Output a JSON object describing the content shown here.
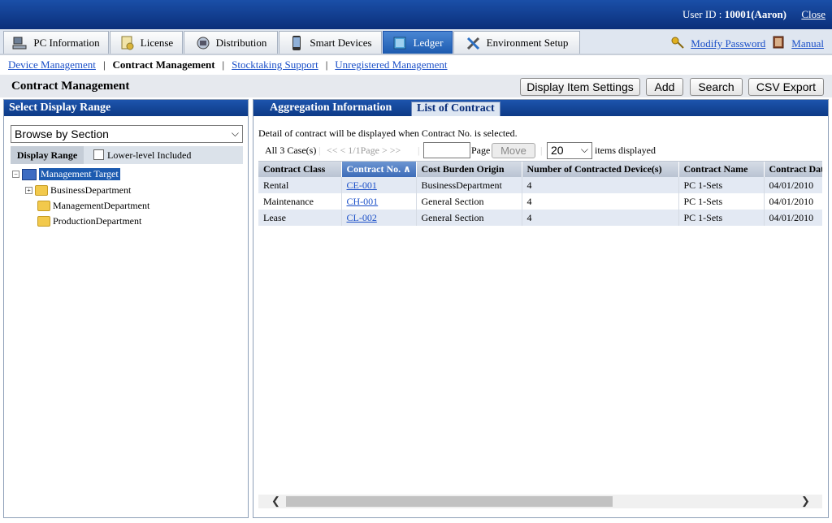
{
  "header": {
    "user_label": "User ID : ",
    "user_value": "10001(Aaron)",
    "close": "Close"
  },
  "tabs": [
    {
      "label": "PC Information",
      "icon": "pc-icon"
    },
    {
      "label": "License",
      "icon": "license-icon"
    },
    {
      "label": "Distribution",
      "icon": "distribution-icon"
    },
    {
      "label": "Smart Devices",
      "icon": "smart-device-icon"
    },
    {
      "label": "Ledger",
      "icon": "ledger-icon",
      "active": true
    },
    {
      "label": "Environment Setup",
      "icon": "tools-icon"
    }
  ],
  "toplinks": {
    "modify_password": "Modify Password",
    "manual": "Manual"
  },
  "subnav": [
    {
      "label": "Device Management"
    },
    {
      "label": "Contract Management",
      "current": true
    },
    {
      "label": "Stocktaking Support"
    },
    {
      "label": "Unregistered Management"
    }
  ],
  "page_title": "Contract Management",
  "buttons": {
    "display_item_settings": "Display Item Settings",
    "add": "Add",
    "search": "Search",
    "csv_export": "CSV Export"
  },
  "left": {
    "title": "Select Display Range",
    "browse_select": "Browse by Section",
    "display_range": "Display Range",
    "lower_level": "Lower-level Included",
    "tree": {
      "root": "Management Target",
      "children": [
        "BusinessDepartment",
        "ManagementDepartment",
        "ProductionDepartment"
      ]
    }
  },
  "right": {
    "tabs": [
      "Aggregation Information",
      "List of Contract"
    ],
    "info": "Detail of contract will be displayed when Contract No. is selected.",
    "pager": {
      "count": "All 3 Case(s)",
      "nav": "<< < 1/1Page > >>",
      "page_label": "Page",
      "move": "Move",
      "per_page": "20",
      "items_displayed": "items displayed"
    },
    "columns": [
      "Contract Class",
      "Contract No.",
      "Cost Burden Origin",
      "Number of Contracted Device(s)",
      "Contract Name",
      "Contract Date"
    ],
    "rows": [
      [
        "Rental",
        "CE-001",
        "BusinessDepartment",
        "4",
        "PC 1-Sets",
        "04/01/2010"
      ],
      [
        "Maintenance",
        "CH-001",
        "General Section",
        "4",
        "PC 1-Sets",
        "04/01/2010"
      ],
      [
        "Lease",
        "CL-002",
        "General Section",
        "4",
        "PC 1-Sets",
        "04/01/2010"
      ]
    ]
  }
}
